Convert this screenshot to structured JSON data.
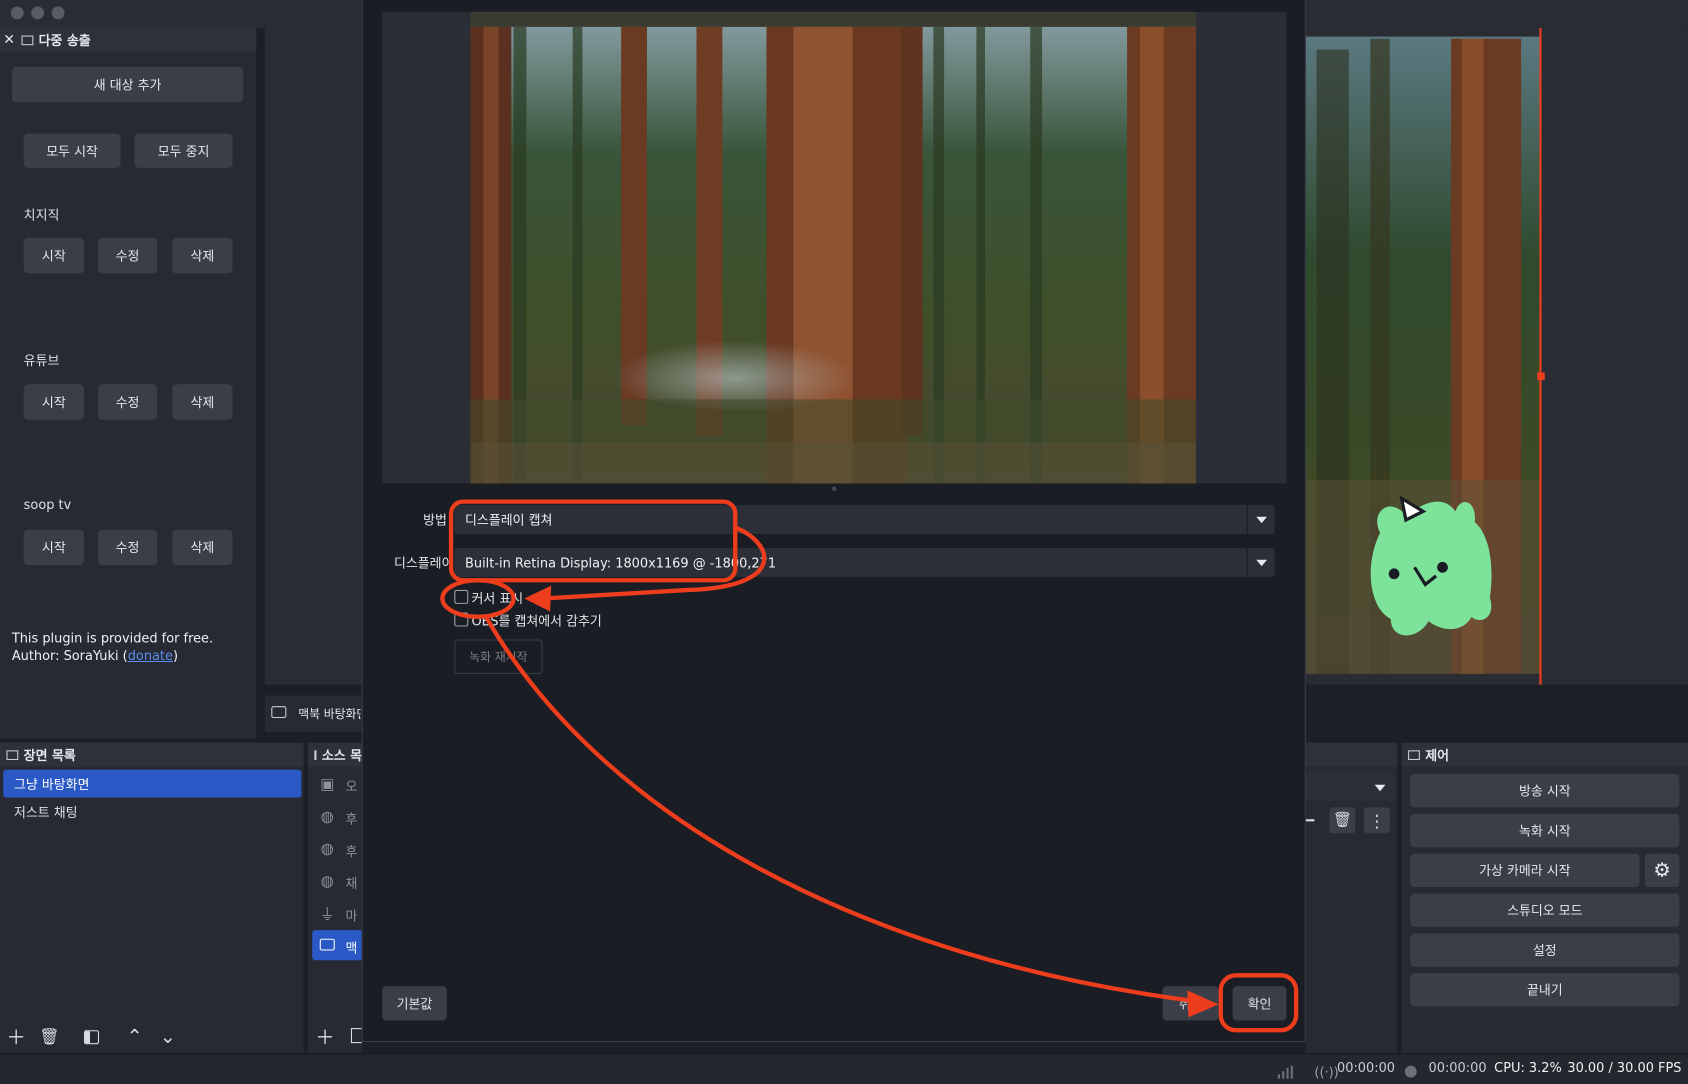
{
  "multistream": {
    "header": "다중 송출",
    "add_target": "새 대상 추가",
    "start_all": "모두 시작",
    "stop_all": "모두 중지",
    "targets": [
      {
        "name": "치지직",
        "start": "시작",
        "edit": "수정",
        "delete": "삭제"
      },
      {
        "name": "유튜브",
        "start": "시작",
        "edit": "수정",
        "delete": "삭제"
      },
      {
        "name": "soop tv",
        "start": "시작",
        "edit": "수정",
        "delete": "삭제"
      }
    ],
    "footer_line1": "This plugin is provided for free.",
    "footer_author_prefix": "Author: SoraYuki (",
    "footer_link": "donate",
    "footer_author_suffix": ")"
  },
  "preview": {
    "source_bar_label": "맥북 바탕화면"
  },
  "scenes": {
    "header": "장면 목록",
    "items": [
      "그냥 바탕화면",
      "저스트 채팅"
    ],
    "selected_index": 0
  },
  "sources": {
    "header": "소스 목",
    "items": [
      "오",
      "후",
      "후",
      "채",
      "마",
      "맥"
    ],
    "icons": [
      "image-icon",
      "globe-icon",
      "globe-icon",
      "globe-icon",
      "microphone-icon",
      "monitor-icon"
    ],
    "selected_index": 5
  },
  "controls": {
    "header": "제어",
    "start_stream": "방송 시작",
    "start_record": "녹화 시작",
    "virtual_cam": "가상 카메라 시작",
    "studio_mode": "스튜디오 모드",
    "settings": "설정",
    "exit": "끝내기"
  },
  "dialog": {
    "method_label": "방법",
    "method_value": "디스플레이 캡쳐",
    "display_label": "디스플레이",
    "display_value": "Built-in Retina Display: 1800x1169 @ -1800,271",
    "show_cursor": "커서 표시",
    "hide_obs": "OBS를 캡쳐에서 감추기",
    "restart_capture": "녹화 재시작",
    "defaults_button": "기본값",
    "cancel_button": "취소",
    "ok_button": "확인",
    "show_cursor_checked": false,
    "hide_obs_checked": false
  },
  "statusbar": {
    "stream_time": "00:00:00",
    "record_time": "00:00:00",
    "cpu": "CPU: 3.2%",
    "fps": "30.00 / 30.00 FPS"
  },
  "colors": {
    "annotation": "#ee3d1c",
    "selection": "#2a58c4",
    "mascot": "#7de39a",
    "link": "#5b8ef0"
  }
}
